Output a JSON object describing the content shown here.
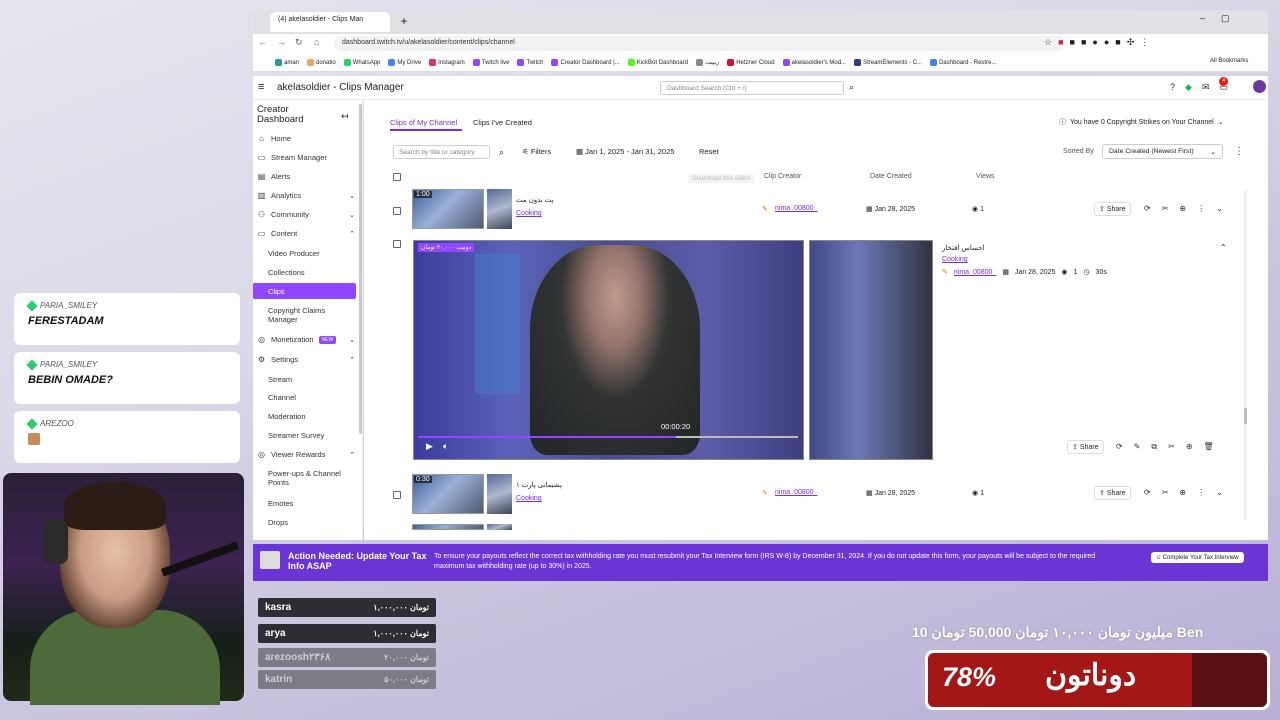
{
  "browser": {
    "tab_title": "(4) akelasoldier - Clips Man",
    "url": "dashboard.twitch.tv/u/akelasoldier/content/clips/channel",
    "bookmarks": [
      "aman",
      "donatio",
      "WhatsApp",
      "My Drive",
      "Instagram",
      "Twitch live",
      "Twitch",
      "Creator Dashboard |...",
      "KickBot Dashboard",
      "زیپیت",
      "Hetzner Cloud",
      "akelasoldier's Mod...",
      "StreamElements - C...",
      "Dashboard - Restre..."
    ],
    "all_bookmarks": "All Bookmarks",
    "notif_count": "4"
  },
  "header": {
    "title": "akelasoldier - Clips Manager",
    "search_placeholder": "Dashboard Search (Ctrl + /)"
  },
  "sidebar": {
    "title": "Creator Dashboard",
    "items": {
      "home": "Home",
      "stream_manager": "Stream Manager",
      "alerts": "Alerts",
      "analytics": "Analytics",
      "community": "Community",
      "content": "Content",
      "video_producer": "Video Producer",
      "collections": "Collections",
      "clips": "Clips",
      "copyright": "Copyright Claims Manager",
      "monetization": "Monetization",
      "new": "NEW",
      "settings": "Settings",
      "stream": "Stream",
      "channel": "Channel",
      "moderation": "Moderation",
      "streamer_survey": "Streamer Survey",
      "viewer_rewards": "Viewer Rewards",
      "powerups": "Power-ups & Channel Points",
      "emotes": "Emotes",
      "drops": "Drops"
    }
  },
  "main": {
    "tabs": [
      "Clips of My Channel",
      "Clips I've Created"
    ],
    "strikes": "You have 0 Copyright Strikes on Your Channel",
    "search_placeholder": "Search by title or category",
    "filters": "Filters",
    "date_range": "Jan 1, 2025 - Jan 31, 2025",
    "reset": "Reset",
    "sorted_by": "Sorted By",
    "sort_value": "Date Created (Newest First)",
    "columns": {
      "clip_creator": "Clip Creator",
      "date_created": "Date Created",
      "views": "Views"
    },
    "download_tooltip": "Download this video",
    "share": "Share",
    "clips": [
      {
        "duration": "1:00",
        "title": "پت بدون مت",
        "category": "Cooking",
        "creator": "nima_00800_",
        "date": "Jan 28, 2025",
        "views": "1"
      },
      {
        "title": "احساس افتخار",
        "category": "Cooking",
        "creator": "nima_00800_",
        "date": "Jan 28, 2025",
        "views": "1",
        "length": "30s",
        "timecode": "00:00:20",
        "overlay": "دونیت ۳۰,۰۰۰ تومان"
      },
      {
        "duration": "0:30",
        "title": "پشیمانی پارت ۱",
        "category": "Cooking",
        "creator": "nima_00800_",
        "date": "Jan 28, 2025",
        "views": "1"
      }
    ]
  },
  "banner": {
    "title": "Action Needed: Update Your Tax Info ASAP",
    "message": "To ensure your payouts reflect the correct tax withholding rate you must resubmit your Tax Interview form (IRS W-8) by December 31, 2024. If you do not update this form, your payouts will be subject to the required maximum tax withholding rate (up to 30%) in 2025.",
    "button": "Complete Your Tax Interview"
  },
  "chat": [
    {
      "user": "PARIA_SMILEY",
      "message": "FERESTADAM"
    },
    {
      "user": "PARIA_SMILEY",
      "message": "BEBIN OMADE?"
    },
    {
      "user": "AREZOO",
      "message": ""
    }
  ],
  "donations": [
    {
      "name": "kasra",
      "amount": "۱,۰۰۰,۰۰۰ تومان"
    },
    {
      "name": "arya",
      "amount": "۱,۰۰۰,۰۰۰ تومان"
    },
    {
      "name": "arezoosh۲۳۶۸",
      "amount": "۲۰,۰۰۰ تومان"
    },
    {
      "name": "katrin",
      "amount": "۵۰,۰۰۰ تومان"
    }
  ],
  "goal": {
    "text": "10 میلیون تومان ۱۰,۰۰۰ تومان 50,000 تومان Ben",
    "percent": "78%",
    "percent_value": 78,
    "name": "دوناتون"
  }
}
